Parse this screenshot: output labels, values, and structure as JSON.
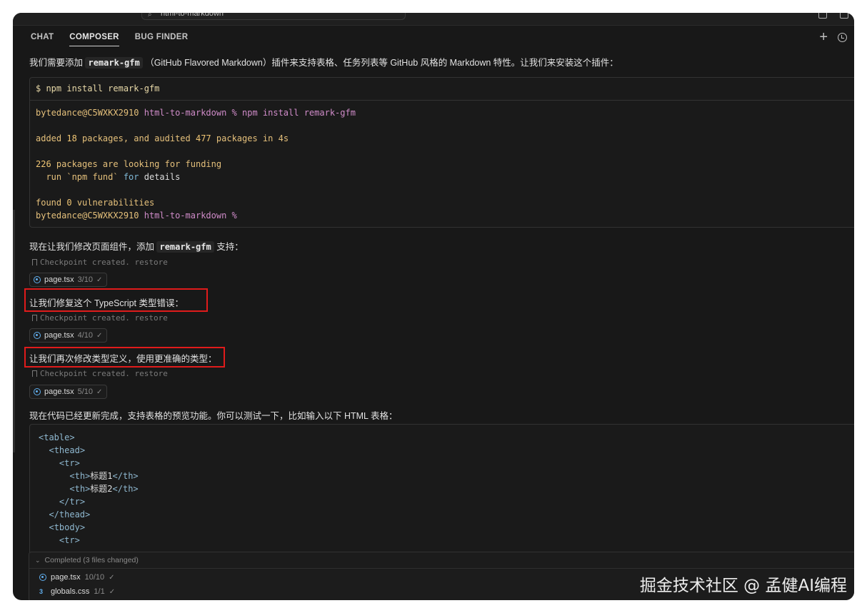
{
  "titlebar": {
    "search_text": "html-to-markdown"
  },
  "tabs": [
    {
      "label": "CHAT"
    },
    {
      "label": "COMPOSER"
    },
    {
      "label": "BUG FINDER"
    }
  ],
  "messages": {
    "m1_pre": "我们需要添加 ",
    "m1_code": "remark-gfm",
    "m1_post": " （GitHub Flavored Markdown）插件来支持表格、任务列表等 GitHub 风格的 Markdown 特性。让我们来安装这个插件：",
    "m2_pre": "现在让我们修改页面组件，添加 ",
    "m2_code": "remark-gfm",
    "m2_post": " 支持：",
    "m3": "让我们修复这个 TypeScript 类型错误：",
    "m4": "让我们再次修改类型定义，使用更准确的类型：",
    "m5": "现在代码已经更新完成，支持表格的预览功能。你可以测试一下，比如输入以下 HTML 表格："
  },
  "terminal": {
    "command": "$ npm install remark-gfm",
    "prompt_user": "bytedance@C5WXKX2910",
    "prompt_dir": " html-to-markdown % ",
    "prompt_cmd": "npm install remark-gfm",
    "added_1": "added ",
    "added_n1": "18",
    "added_2": " packages, and audited ",
    "added_n2": "477",
    "added_3": " packages in 4s",
    "fund_n": "226",
    "fund_text": " packages are looking for funding",
    "run_1": "  run `npm fund` ",
    "run_for": "for",
    "run_2": " details",
    "found_1": "found ",
    "found_n": "0",
    "found_2": " vulnerabilities",
    "prompt_end": " html-to-markdown %"
  },
  "checkpoint": {
    "text": "Checkpoint created.",
    "restore": "restore"
  },
  "chips": [
    {
      "file": "page.tsx",
      "count": "3/10"
    },
    {
      "file": "page.tsx",
      "count": "4/10"
    },
    {
      "file": "page.tsx",
      "count": "5/10"
    }
  ],
  "code_lines": [
    {
      "indent": "",
      "open": "<",
      "tag": "table",
      "close": ">",
      "text": "",
      "end": ""
    },
    {
      "indent": "  ",
      "open": "<",
      "tag": "thead",
      "close": ">",
      "text": "",
      "end": ""
    },
    {
      "indent": "    ",
      "open": "<",
      "tag": "tr",
      "close": ">",
      "text": "",
      "end": ""
    },
    {
      "indent": "      ",
      "open": "<",
      "tag": "th",
      "close": ">",
      "text": "标题1",
      "end": "</th>"
    },
    {
      "indent": "      ",
      "open": "<",
      "tag": "th",
      "close": ">",
      "text": "标题2",
      "end": "</th>"
    },
    {
      "indent": "    ",
      "open": "</",
      "tag": "tr",
      "close": ">",
      "text": "",
      "end": ""
    },
    {
      "indent": "  ",
      "open": "</",
      "tag": "thead",
      "close": ">",
      "text": "",
      "end": ""
    },
    {
      "indent": "  ",
      "open": "<",
      "tag": "tbody",
      "close": ">",
      "text": "",
      "end": ""
    },
    {
      "indent": "    ",
      "open": "<",
      "tag": "tr",
      "close": ">",
      "text": "",
      "end": ""
    }
  ],
  "completed": {
    "title": "Completed",
    "changed": "(3 files changed)",
    "files": [
      {
        "file": "page.tsx",
        "count": "10/10"
      },
      {
        "file": "globals.css",
        "count": "1/1"
      }
    ]
  },
  "watermark": "掘金技术社区 @ 孟健AI编程",
  "colors": {
    "highlight": "#e01b1b",
    "react_icon": "#61afef"
  }
}
